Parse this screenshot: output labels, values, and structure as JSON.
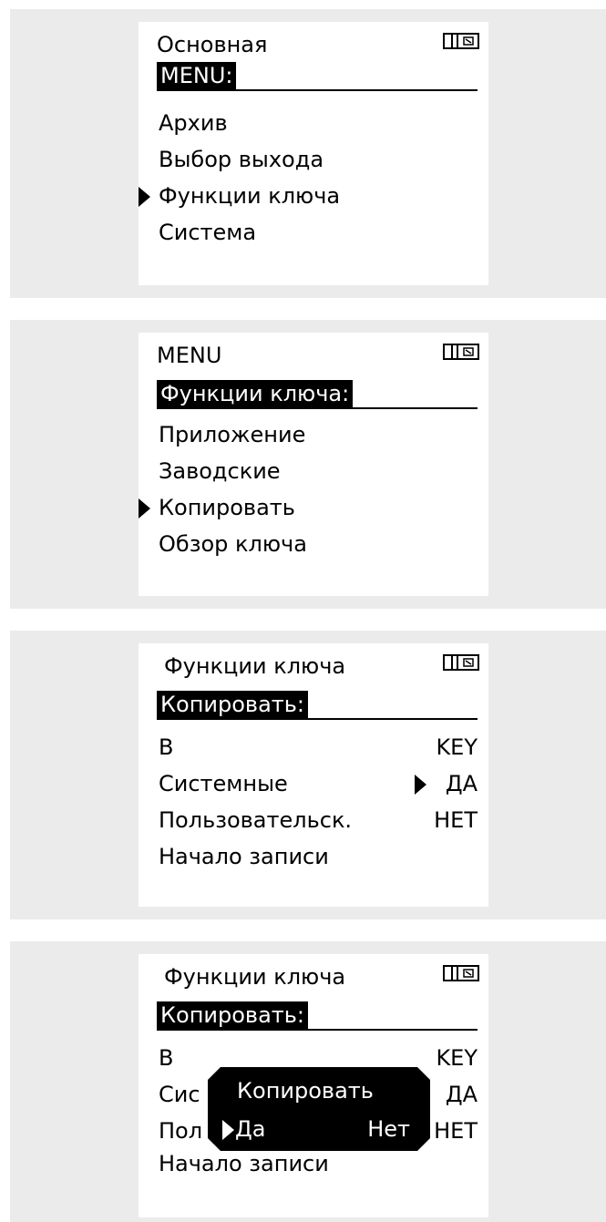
{
  "screens": [
    {
      "header": "Основная",
      "title": "MENU:",
      "items": [
        "Архив",
        "Выбор выхода",
        "Функции ключа",
        "Система"
      ],
      "selected_index": 2
    },
    {
      "header": "MENU",
      "title": "Функции ключа:",
      "items": [
        "Приложение",
        "Заводские",
        "Копировать",
        "Обзор ключа"
      ],
      "selected_index": 2
    },
    {
      "header": "Функции ключа",
      "title": "Копировать:",
      "rows": [
        {
          "label": "В",
          "value": "KEY"
        },
        {
          "label": "Системные",
          "value": "ДА"
        },
        {
          "label": "Пользовательск.",
          "value": "НЕТ"
        },
        {
          "label": "Начало записи",
          "value": ""
        }
      ],
      "selected_row": 1
    },
    {
      "header": "Функции ключа",
      "title": "Копировать:",
      "rows": [
        {
          "label": "В",
          "value": "KEY"
        },
        {
          "label": "Сис",
          "value": "ДА"
        },
        {
          "label": "Пол",
          "value": "НЕТ"
        },
        {
          "label": "Начало записи",
          "value": ""
        }
      ],
      "dialog": {
        "title": "Копировать",
        "yes": "Да",
        "no": "Нет",
        "selected": "yes"
      }
    }
  ],
  "icons": {
    "key": "key-status-icon",
    "selector": "selector-arrow-icon"
  }
}
